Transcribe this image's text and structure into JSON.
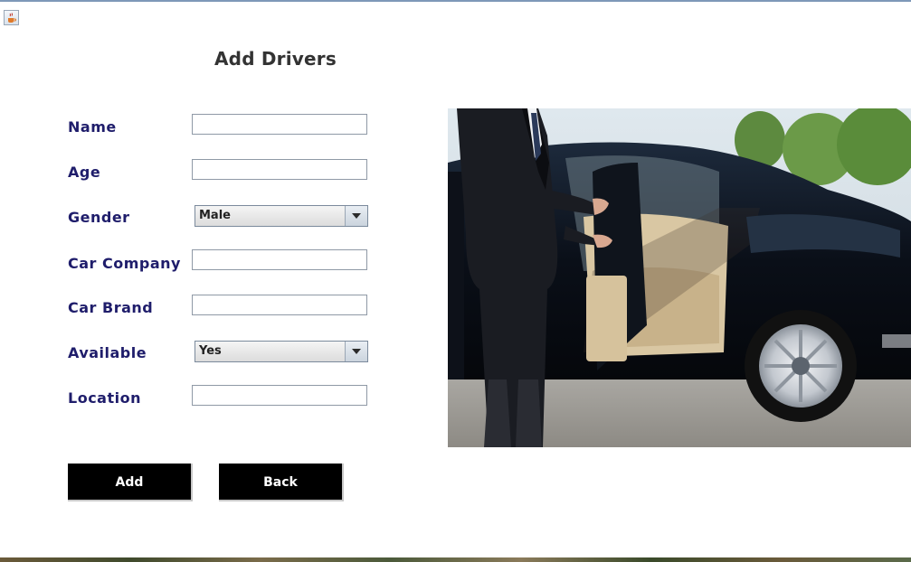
{
  "title": "Add Drivers",
  "form": {
    "name": {
      "label": "Name",
      "value": ""
    },
    "age": {
      "label": "Age",
      "value": ""
    },
    "gender": {
      "label": "Gender",
      "selected": "Male"
    },
    "car_company": {
      "label": "Car Company",
      "value": ""
    },
    "car_brand": {
      "label": "Car Brand",
      "value": ""
    },
    "available": {
      "label": "Available",
      "selected": "Yes"
    },
    "location": {
      "label": "Location",
      "value": ""
    }
  },
  "buttons": {
    "add": "Add",
    "back": "Back"
  },
  "icons": {
    "window": "java-coffee-icon",
    "dropdown": "chevron-down-icon"
  },
  "colors": {
    "label": "#1f1d6b",
    "button_bg": "#000000",
    "title": "#333333"
  }
}
